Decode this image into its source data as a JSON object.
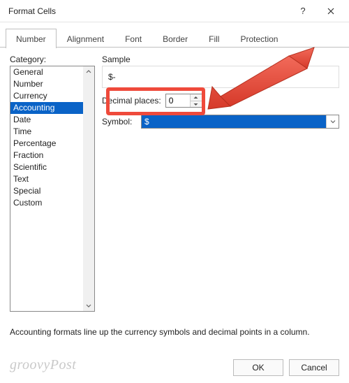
{
  "window": {
    "title": "Format Cells",
    "help": "?",
    "close": "×"
  },
  "tabs": {
    "items": [
      {
        "label": "Number"
      },
      {
        "label": "Alignment"
      },
      {
        "label": "Font"
      },
      {
        "label": "Border"
      },
      {
        "label": "Fill"
      },
      {
        "label": "Protection"
      }
    ],
    "active": 0
  },
  "category": {
    "label": "Category:",
    "items": [
      "General",
      "Number",
      "Currency",
      "Accounting",
      "Date",
      "Time",
      "Percentage",
      "Fraction",
      "Scientific",
      "Text",
      "Special",
      "Custom"
    ],
    "selected": 3
  },
  "sample": {
    "label": "Sample",
    "value": "$-"
  },
  "decimal": {
    "label": "Decimal places:",
    "value": "0"
  },
  "symbol": {
    "label": "Symbol:",
    "value": "$"
  },
  "description": "Accounting formats line up the currency symbols and decimal points in a column.",
  "buttons": {
    "ok": "OK",
    "cancel": "Cancel"
  },
  "watermark": "groovyPost"
}
